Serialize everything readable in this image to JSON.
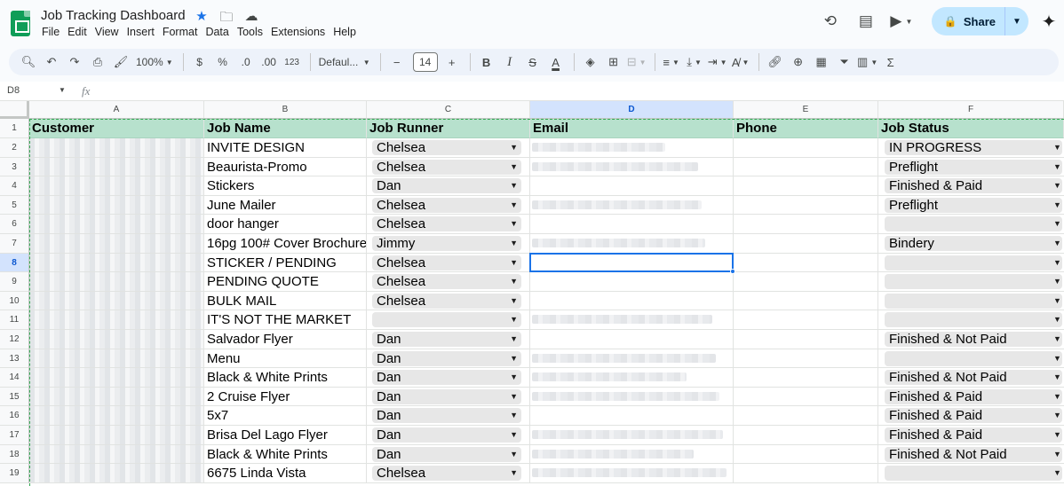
{
  "app": {
    "doc_title": "Job Tracking Dashboard",
    "menu": [
      "File",
      "Edit",
      "View",
      "Insert",
      "Format",
      "Data",
      "Tools",
      "Extensions",
      "Help"
    ],
    "share_label": "Share",
    "accent": "#0f9d58"
  },
  "toolbar": {
    "zoom": "100%",
    "currency": "$",
    "percent": "%",
    "decrease_decimal": ".0",
    "increase_decimal": ".00",
    "number_format": "123",
    "font": "Defaul...",
    "font_size": "14",
    "minus": "−",
    "plus": "+",
    "bold": "B",
    "italic": "I",
    "strike": "S",
    "text_color": "A",
    "sum": "Σ"
  },
  "formula_bar": {
    "cell_ref": "D8",
    "fx": "fx"
  },
  "columns": [
    "A",
    "B",
    "C",
    "D",
    "E",
    "F"
  ],
  "header_row": {
    "row_number": "1",
    "customer": "Customer",
    "job_name": "Job Name",
    "job_runner": "Job Runner",
    "email": "Email",
    "phone": "Phone",
    "job_status": "Job Status"
  },
  "rows": [
    {
      "n": "2",
      "job": "INVITE DESIGN",
      "runner": "Chelsea",
      "status": "IN PROGRESS"
    },
    {
      "n": "3",
      "job": "Beaurista-Promo",
      "runner": "Chelsea",
      "status": "Preflight"
    },
    {
      "n": "4",
      "job": "Stickers",
      "runner": "Dan",
      "status": "Finished & Paid"
    },
    {
      "n": "5",
      "job": "June Mailer",
      "runner": "Chelsea",
      "status": "Preflight"
    },
    {
      "n": "6",
      "job": "door hanger",
      "runner": "Chelsea",
      "status": ""
    },
    {
      "n": "7",
      "job": "16pg 100# Cover Brochure",
      "runner": "Jimmy",
      "status": "Bindery"
    },
    {
      "n": "8",
      "job": "STICKER / PENDING",
      "runner": "Chelsea",
      "status": ""
    },
    {
      "n": "9",
      "job": "PENDING QUOTE",
      "runner": "Chelsea",
      "status": ""
    },
    {
      "n": "10",
      "job": "BULK MAIL",
      "runner": "Chelsea",
      "status": ""
    },
    {
      "n": "11",
      "job": "IT'S NOT THE MARKET",
      "runner": "",
      "status": ""
    },
    {
      "n": "12",
      "job": "Salvador Flyer",
      "runner": "Dan",
      "status": "Finished & Not Paid"
    },
    {
      "n": "13",
      "job": "Menu",
      "runner": "Dan",
      "status": ""
    },
    {
      "n": "14",
      "job": "Black & White Prints",
      "runner": "Dan",
      "status": "Finished & Not Paid"
    },
    {
      "n": "15",
      "job": "2 Cruise Flyer",
      "runner": "Dan",
      "status": "Finished & Paid"
    },
    {
      "n": "16",
      "job": "5x7",
      "runner": "Dan",
      "status": "Finished & Paid"
    },
    {
      "n": "17",
      "job": "Brisa Del Lago Flyer",
      "runner": "Dan",
      "status": "Finished & Paid"
    },
    {
      "n": "18",
      "job": "Black & White Prints",
      "runner": "Dan",
      "status": "Finished & Not Paid"
    },
    {
      "n": "19",
      "job": "6675 Linda Vista",
      "runner": "Chelsea",
      "status": ""
    }
  ],
  "email_blurred_rows": [
    "2",
    "3",
    "5",
    "7",
    "11",
    "13",
    "14",
    "15",
    "17",
    "18",
    "19"
  ],
  "selected_cell": "D8",
  "colors": {
    "header_fill": "#b7e1cd",
    "chip_fill": "#e7e7e7",
    "selection": "#1a73e8",
    "share_fill": "#c2e7ff"
  }
}
